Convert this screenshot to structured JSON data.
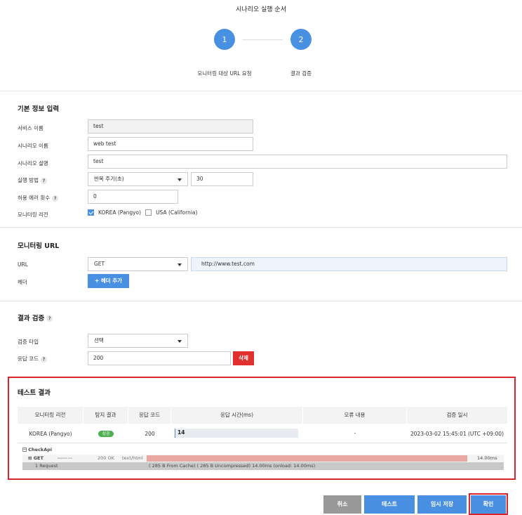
{
  "header": {
    "title": "시나리오 실행 순서"
  },
  "stepper": {
    "steps": [
      {
        "number": "1",
        "label": "모니터링 대상 URL 요청"
      },
      {
        "number": "2",
        "label": "결과 검증"
      }
    ]
  },
  "basic_info": {
    "title": "기본 정보 입력",
    "service_name_label": "서비스 이름",
    "service_name_value": "test",
    "scenario_name_label": "시나리오 이름",
    "scenario_name_value": "web test",
    "scenario_desc_label": "시나리오 설명",
    "scenario_desc_value": "test",
    "exec_method_label": "실행 방법",
    "exec_method_select": "반복 주기(초)",
    "exec_interval_value": "30",
    "allowed_errors_label": "허용 에러 횟수",
    "allowed_errors_value": "0",
    "region_label": "모니터링 리전",
    "regions": [
      {
        "label": "KOREA (Pangyo)",
        "checked": true
      },
      {
        "label": "USA (California)",
        "checked": false
      }
    ]
  },
  "monitoring_url": {
    "title": "모니터링 URL",
    "url_label": "URL",
    "method_select": "GET",
    "url_value": "http://www.test.com",
    "header_label": "헤더",
    "add_header_button": "+ 헤더 추가"
  },
  "result_validation": {
    "title": "결과 검증",
    "type_label": "검증 타입",
    "type_select": "선택",
    "code_label": "응답 코드",
    "code_value": "200",
    "delete_button": "삭제"
  },
  "test_result": {
    "title": "테스트 결과",
    "columns": [
      "모니터링 리전",
      "탐지 결과",
      "응답 코드",
      "응답 시간(ms)",
      "오류 내용",
      "검증 일시"
    ],
    "row": {
      "region": "KOREA (Pangyo)",
      "status": "성공",
      "code": "200",
      "response_time": "14",
      "error": "-",
      "datetime": "2023-03-02 15:45:01 (UTC +09:00)"
    },
    "har": {
      "group": "CheckApi",
      "entry_method": "GET",
      "entry_url": "www.test.com",
      "entry_status": "200 OK",
      "entry_type": "text/html",
      "entry_time": "14.00ms",
      "summary_requests": "1 Request",
      "summary_detail": "(    285 B    From Cache)  (    285 B    Uncompressed)    14.00ms (onload: 14.00ms)"
    }
  },
  "footer": {
    "cancel": "취소",
    "test": "테스트",
    "save_draft": "임시 저장",
    "confirm": "확인"
  },
  "colors": {
    "accent": "#4a90e2",
    "danger": "#d9232d",
    "gray_button": "#999999"
  }
}
